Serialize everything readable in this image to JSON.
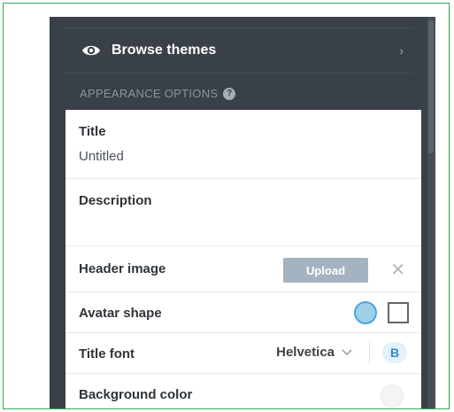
{
  "sidebar": {
    "browse_themes": {
      "label": "Browse themes",
      "icon": "eye-icon",
      "chevron": "›"
    },
    "section_label": "APPEARANCE OPTIONS",
    "help_glyph": "?"
  },
  "options": {
    "title": {
      "label": "Title",
      "value": "Untitled"
    },
    "description": {
      "label": "Description",
      "value": ""
    },
    "header_image": {
      "label": "Header image",
      "upload_label": "Upload",
      "remove_glyph": "✕"
    },
    "avatar_shape": {
      "label": "Avatar shape",
      "selected": "circle"
    },
    "title_font": {
      "label": "Title font",
      "font": "Helvetica",
      "bold_label": "B"
    },
    "background_color": {
      "label": "Background color"
    }
  },
  "colors": {
    "panel": "#3a4047",
    "accent": "#4aa5d8",
    "upload_button": "#a4b3c1",
    "frame_border": "#2fa84f"
  }
}
